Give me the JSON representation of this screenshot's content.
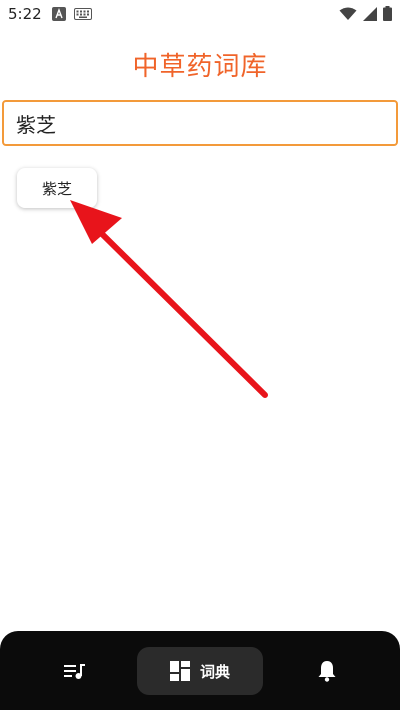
{
  "status_bar": {
    "time": "5:22",
    "left_icons": [
      "a-icon",
      "keyboard-icon"
    ],
    "right_icons": [
      "wifi-icon",
      "cellular-icon",
      "battery-icon"
    ]
  },
  "app": {
    "title": "中草药词库"
  },
  "search": {
    "value": "紫芝"
  },
  "results": [
    {
      "label": "紫芝"
    }
  ],
  "annotation": {
    "color": "#e8141b"
  },
  "bottom_nav": {
    "items": [
      {
        "icon": "playlist-music-icon",
        "label": ""
      },
      {
        "icon": "dashboard-icon",
        "label": "词典",
        "active": true
      },
      {
        "icon": "bell-icon",
        "label": ""
      }
    ]
  },
  "colors": {
    "title": "#f0642a",
    "search_border": "#f39a3a",
    "nav_bg": "#0b0b0b",
    "nav_active_bg": "#2b2b2b"
  }
}
